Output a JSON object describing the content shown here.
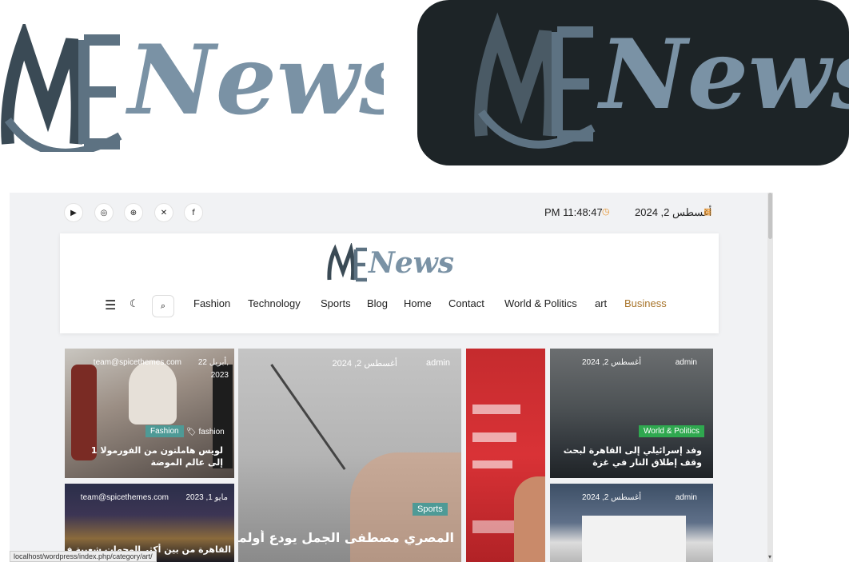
{
  "logo": {
    "part1": "ME",
    "part2": "News"
  },
  "browser": {
    "topbar": {
      "social_icons": [
        "youtube-icon",
        "instagram-icon",
        "dribbble-icon",
        "x-icon",
        "facebook-icon"
      ],
      "time": "PM 11:48:47",
      "date": "أغسطس 2, 2024"
    },
    "nav": {
      "items": [
        "Fashion",
        "Technology",
        "Sports",
        "Blog",
        "Home",
        "Contact",
        "World & Politics",
        "art",
        "Business"
      ],
      "active_index": 8
    },
    "cards": {
      "fashion": {
        "meta_author": "team@spicethemes.com",
        "meta_date": "أبريل 22,",
        "meta_year": "2023",
        "badge": "Fashion",
        "tag": "fashion",
        "title": "لويس هاملتون من الفورمولا 1 إلى عالم الموضة"
      },
      "city": {
        "meta_author": "team@spicethemes.com",
        "meta_date": "مايو 1, 2023",
        "title": "القاهرة من بين أكثر الوجهات شعبية في العالم"
      },
      "sports": {
        "meta_author": "admin",
        "meta_date": "أغسطس 2, 2024",
        "badge": "Sports",
        "title": "المصري مصطفى الجمل يودع أولمبياد"
      },
      "world": {
        "meta_author": "admin",
        "meta_date": "أغسطس 2, 2024",
        "badge": "World & Politics",
        "title": "وفد إسرائيلي إلى القاهرة لبحث وقف إطلاق النار في غزة"
      },
      "whitehouse": {
        "meta_author": "admin",
        "meta_date": "أغسطس 2, 2024"
      }
    },
    "status_url": "localhost/wordpress/index.php/category/art/"
  },
  "colors": {
    "logo_dark": "#33434e",
    "logo_light": "#7a92a5",
    "active_nav": "#a8742a",
    "badge_teal": "#4e9a96",
    "badge_green": "#2fa84f",
    "date_icon": "#e8932a"
  }
}
